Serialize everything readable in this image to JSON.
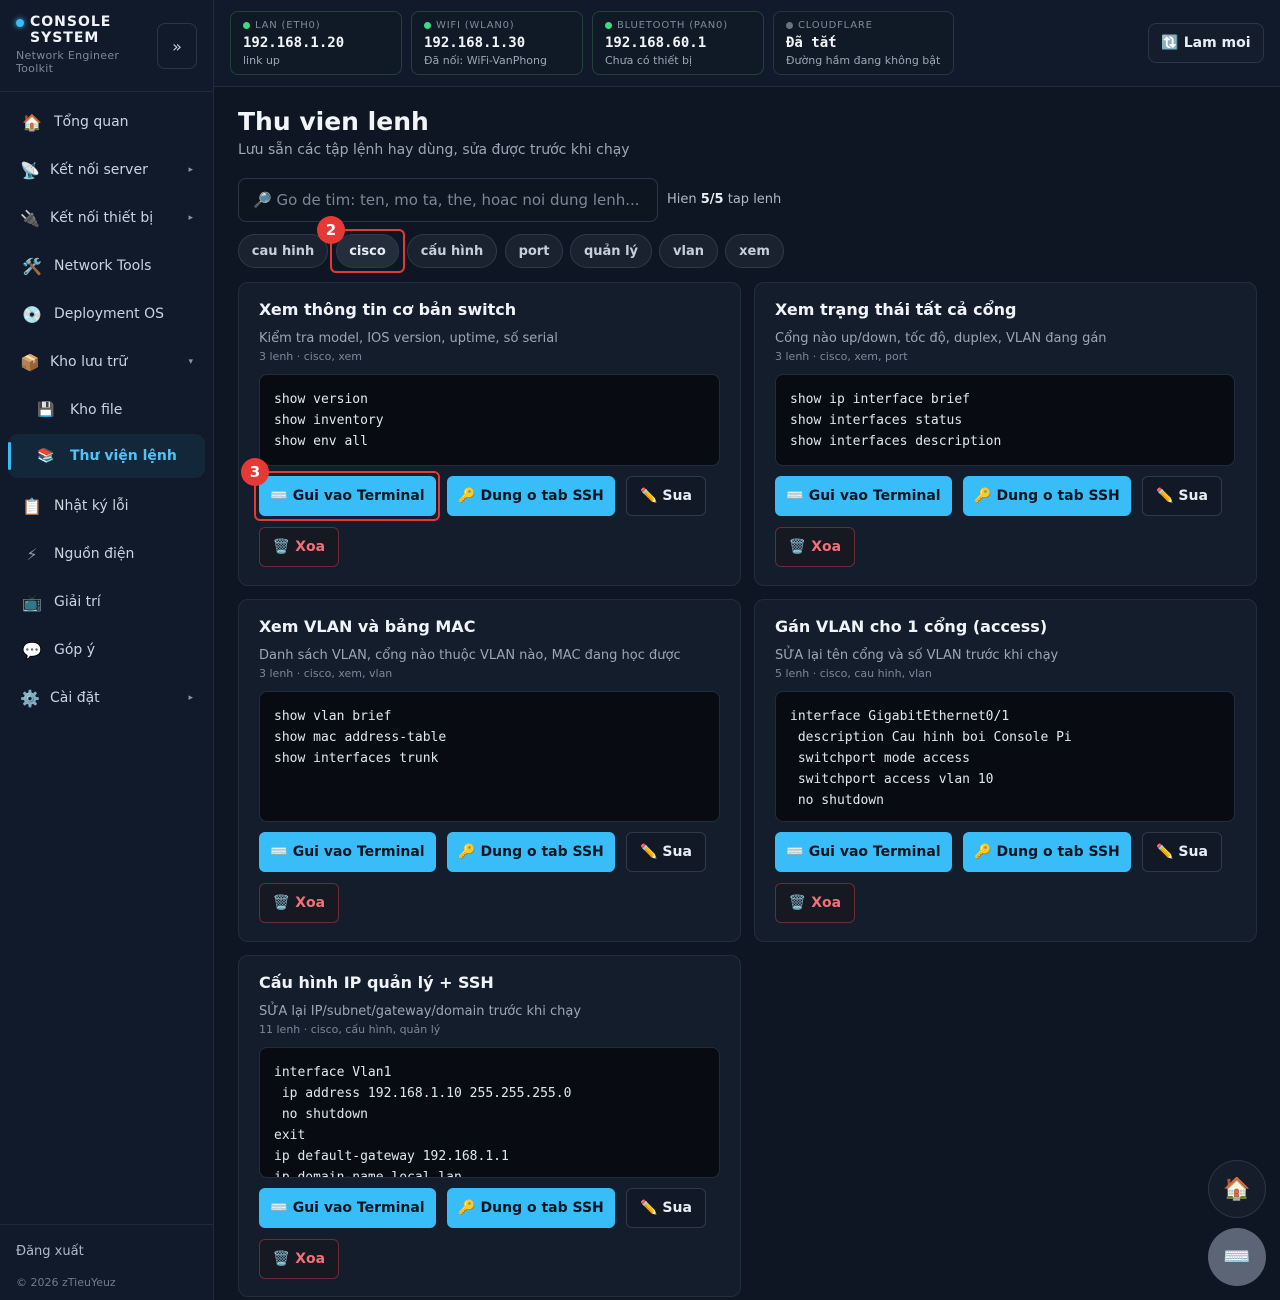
{
  "brand": {
    "title": "CONSOLE SYSTEM",
    "subtitle": "Network Engineer Toolkit",
    "collapse": "»"
  },
  "sidebar": {
    "items": [
      {
        "label": "Tổng quan",
        "icon": "🏠"
      },
      {
        "label": "Kết nối server",
        "icon": "📡",
        "arrow": "▸"
      },
      {
        "label": "Kết nối thiết bị",
        "icon": "🔌",
        "arrow": "▸"
      },
      {
        "label": "Network Tools",
        "icon": "🛠️"
      },
      {
        "label": "Deployment OS",
        "icon": "💿"
      },
      {
        "label": "Kho lưu trữ",
        "icon": "📦",
        "arrow": "▾"
      },
      {
        "label": "Kho file",
        "icon": "💾"
      },
      {
        "label": "Thư viện lệnh",
        "icon": "📚"
      },
      {
        "label": "Nhật ký lỗi",
        "icon": "📋"
      },
      {
        "label": "Nguồn điện",
        "icon": "⚡"
      },
      {
        "label": "Giải trí",
        "icon": "📺"
      },
      {
        "label": "Góp ý",
        "icon": "💬"
      },
      {
        "label": "Cài đặt",
        "icon": "⚙️",
        "arrow": "▸"
      }
    ],
    "logout": "Đăng xuất",
    "copyright": "© 2026 zTieuYeuz"
  },
  "topbar": {
    "networks": [
      {
        "label": "LAN (ETH0)",
        "value": "192.168.1.20",
        "sub": "link up"
      },
      {
        "label": "WIFI (WLAN0)",
        "value": "192.168.1.30",
        "sub": "Đã nối: WiFi-VanPhong"
      },
      {
        "label": "BLUETOOTH (PAN0)",
        "value": "192.168.60.1",
        "sub": "Chưa có thiết bị"
      },
      {
        "label": "CLOUDFLARE",
        "value": "Đã tắt",
        "sub": "Đường hầm đang không bật"
      }
    ],
    "refresh": "🔃 Lam moi"
  },
  "page": {
    "title": "Thu vien lenh",
    "subtitle": "Lưu sẵn các tập lệnh hay dùng, sửa được trước khi chạy",
    "search_placeholder": "🔎 Go de tim: ten, mo ta, the, hoac noi dung lenh...",
    "count_prefix": "Hien ",
    "count_value": "5/5",
    "count_suffix": " tap lenh"
  },
  "tags": [
    "cau hinh",
    "cisco",
    "cấu hình",
    "port",
    "quản lý",
    "vlan",
    "xem"
  ],
  "buttons": {
    "terminal": "⌨️ Gui vao Terminal",
    "ssh": "🔑 Dung o tab SSH",
    "edit": "✏️ Sua",
    "delete": "🗑️ Xoa"
  },
  "cards": [
    {
      "title": "Xem thông tin cơ bản switch",
      "desc": "Kiểm tra model, IOS version, uptime, số serial",
      "meta": "3 lenh · cisco, xem",
      "code": "show version\nshow inventory\nshow env all"
    },
    {
      "title": "Xem trạng thái tất cả cổng",
      "desc": "Cổng nào up/down, tốc độ, duplex, VLAN đang gán",
      "meta": "3 lenh · cisco, xem, port",
      "code": "show ip interface brief\nshow interfaces status\nshow interfaces description"
    },
    {
      "title": "Xem VLAN và bảng MAC",
      "desc": "Danh sách VLAN, cổng nào thuộc VLAN nào, MAC đang học được",
      "meta": "3 lenh · cisco, xem, vlan",
      "code": "show vlan brief\nshow mac address-table\nshow interfaces trunk"
    },
    {
      "title": "Gán VLAN cho 1 cổng (access)",
      "desc": "SỬA lại tên cổng và số VLAN trước khi chạy",
      "meta": "5 lenh · cisco, cau hinh, vlan",
      "code": "interface GigabitEthernet0/1\n description Cau hinh boi Console Pi\n switchport mode access\n switchport access vlan 10\n no shutdown"
    },
    {
      "title": "Cấu hình IP quản lý + SSH",
      "desc": "SỬA lại IP/subnet/gateway/domain trước khi chạy",
      "meta": "11 lenh · cisco, cấu hình, quản lý",
      "code": "interface Vlan1\n ip address 192.168.1.10 255.255.255.0\n no shutdown\nexit\nip default-gateway 192.168.1.1\nip domain-name local.lan"
    }
  ],
  "annotations": [
    "2",
    "3"
  ],
  "fab": {
    "home": "🏠",
    "keyboard": "⌨️"
  }
}
